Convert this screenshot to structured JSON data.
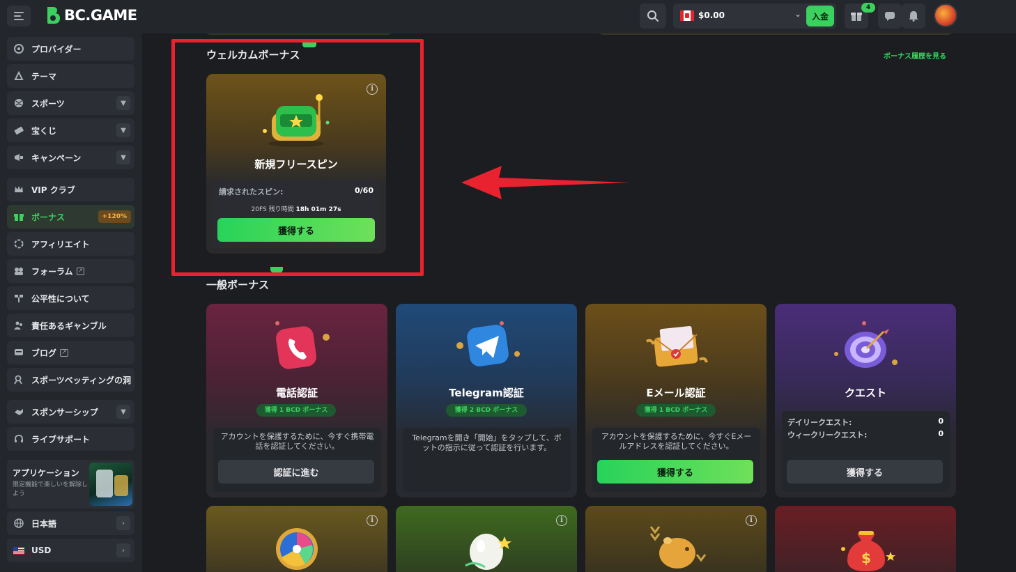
{
  "header": {
    "logo_text": "BC.GAME",
    "balance": "$0.00",
    "deposit_label": "入金",
    "gift_count": "4"
  },
  "sidebar": {
    "items": [
      {
        "label": "プロバイダー"
      },
      {
        "label": "テーマ"
      },
      {
        "label": "スポーツ"
      },
      {
        "label": "宝くじ"
      },
      {
        "label": "キャンペーン"
      },
      {
        "label": "VIP クラブ"
      },
      {
        "label": "ボーナス",
        "badge": "+120%"
      },
      {
        "label": "アフィリエイト"
      },
      {
        "label": "フォーラム"
      },
      {
        "label": "公平性について"
      },
      {
        "label": "責任あるギャンブル"
      },
      {
        "label": "ブログ"
      },
      {
        "label": "スポーツベッティングの洞"
      },
      {
        "label": "スポンサーシップ"
      },
      {
        "label": "ライブサポート"
      }
    ],
    "app": {
      "title": "アプリケーション",
      "subtitle": "限定機能で楽しいを解除しよう"
    },
    "language": "日本語",
    "currency": "USD"
  },
  "welcome": {
    "section_title": "ウェルカムボーナス",
    "history_link": "ボーナス履歴を見る",
    "card": {
      "title": "新規フリースピン",
      "spins_label": "請求されたスピン:",
      "spins_value": "0/60",
      "timer_prefix": "20FS 残り時間",
      "timer_value": "18h 01m 27s",
      "button": "獲得する"
    }
  },
  "general": {
    "section_title": "一般ボーナス",
    "cards": [
      {
        "title": "電話認証",
        "badge": "獲得 1 BCD ボーナス",
        "desc": "アカウントを保護するために、今すぐ携帯電話を認証してください。",
        "button": "認証に進む"
      },
      {
        "title": "Telegram認証",
        "badge": "獲得 2 BCD ボーナス",
        "desc": "Telegramを開き「開始」をタップして、ボットの指示に従って認証を行います。"
      },
      {
        "title": "Eメール認証",
        "badge": "獲得 1 BCD ボーナス",
        "desc": "アカウントを保護するために、今すぐEメールアドレスを認証してください。",
        "button": "獲得する"
      },
      {
        "title": "クエスト",
        "daily_label": "デイリークエスト:",
        "daily_value": "0",
        "weekly_label": "ウィークリークエスト:",
        "weekly_value": "0",
        "button": "獲得する"
      }
    ]
  },
  "colors": {
    "accent": "#3bd15f",
    "highlight_box": "#e8222e",
    "arrow": "#e8222e"
  }
}
